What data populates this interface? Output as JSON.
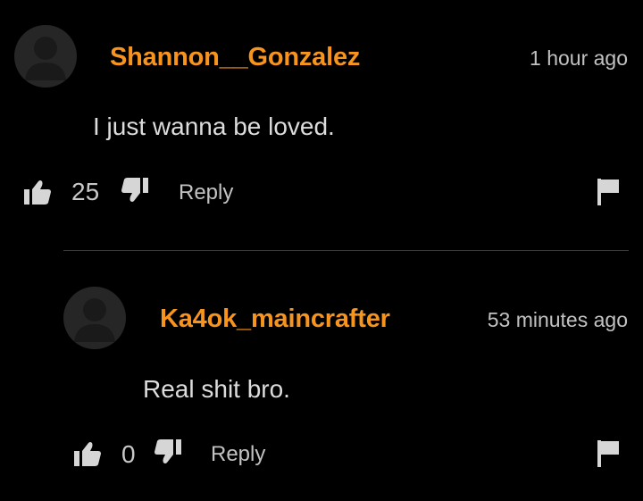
{
  "colors": {
    "background": "#000000",
    "username": "#f7941e",
    "text": "#dcdcdc",
    "muted": "#c2c2c2",
    "avatar": "#262626",
    "divider": "#3a3a3a"
  },
  "comments": [
    {
      "username": "Shannon__Gonzalez",
      "timestamp": "1 hour ago",
      "text": "I just wanna be loved.",
      "likes": "25",
      "reply_label": "Reply",
      "icons": [
        "avatar-icon",
        "thumbs-up-icon",
        "thumbs-down-icon",
        "flag-icon"
      ]
    },
    {
      "username": "Ka4ok_maincrafter",
      "timestamp": "53 minutes ago",
      "text": "Real shit bro.",
      "likes": "0",
      "reply_label": "Reply",
      "icons": [
        "avatar-icon",
        "thumbs-up-icon",
        "thumbs-down-icon",
        "flag-icon"
      ]
    }
  ]
}
